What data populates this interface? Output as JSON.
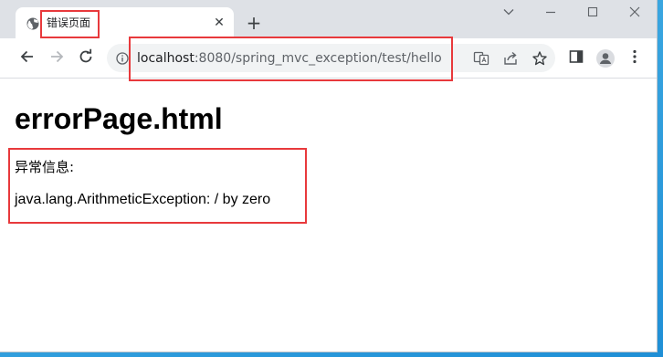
{
  "tab": {
    "title": "错误页面",
    "favicon": "globe-icon",
    "close": "✕"
  },
  "new_tab_label": "+",
  "window_controls": {
    "dropdown": "chevron-down-icon",
    "minimize": "minimize-icon",
    "maximize": "maximize-icon",
    "close": "close-icon"
  },
  "toolbar": {
    "back": "back-arrow-icon",
    "forward": "forward-arrow-icon",
    "reload": "reload-icon"
  },
  "address": {
    "host": "localhost",
    "rest": ":8080/spring_mvc_exception/test/hello"
  },
  "omnibox_actions": [
    "translate-icon",
    "share-icon",
    "bookmark-star-icon"
  ],
  "toolbar_right": [
    "side-panel-icon",
    "profile-icon",
    "menu-kebab-icon"
  ],
  "page": {
    "heading": "errorPage.html",
    "exception_label": "异常信息:",
    "exception_message": "java.lang.ArithmeticException: / by zero"
  },
  "highlight_color": "#e8393c",
  "colors": {
    "tabstrip": "#dee1e6",
    "omnibox": "#f1f3f4",
    "icon": "#5f6368",
    "desktop": "#3aa6e0"
  }
}
